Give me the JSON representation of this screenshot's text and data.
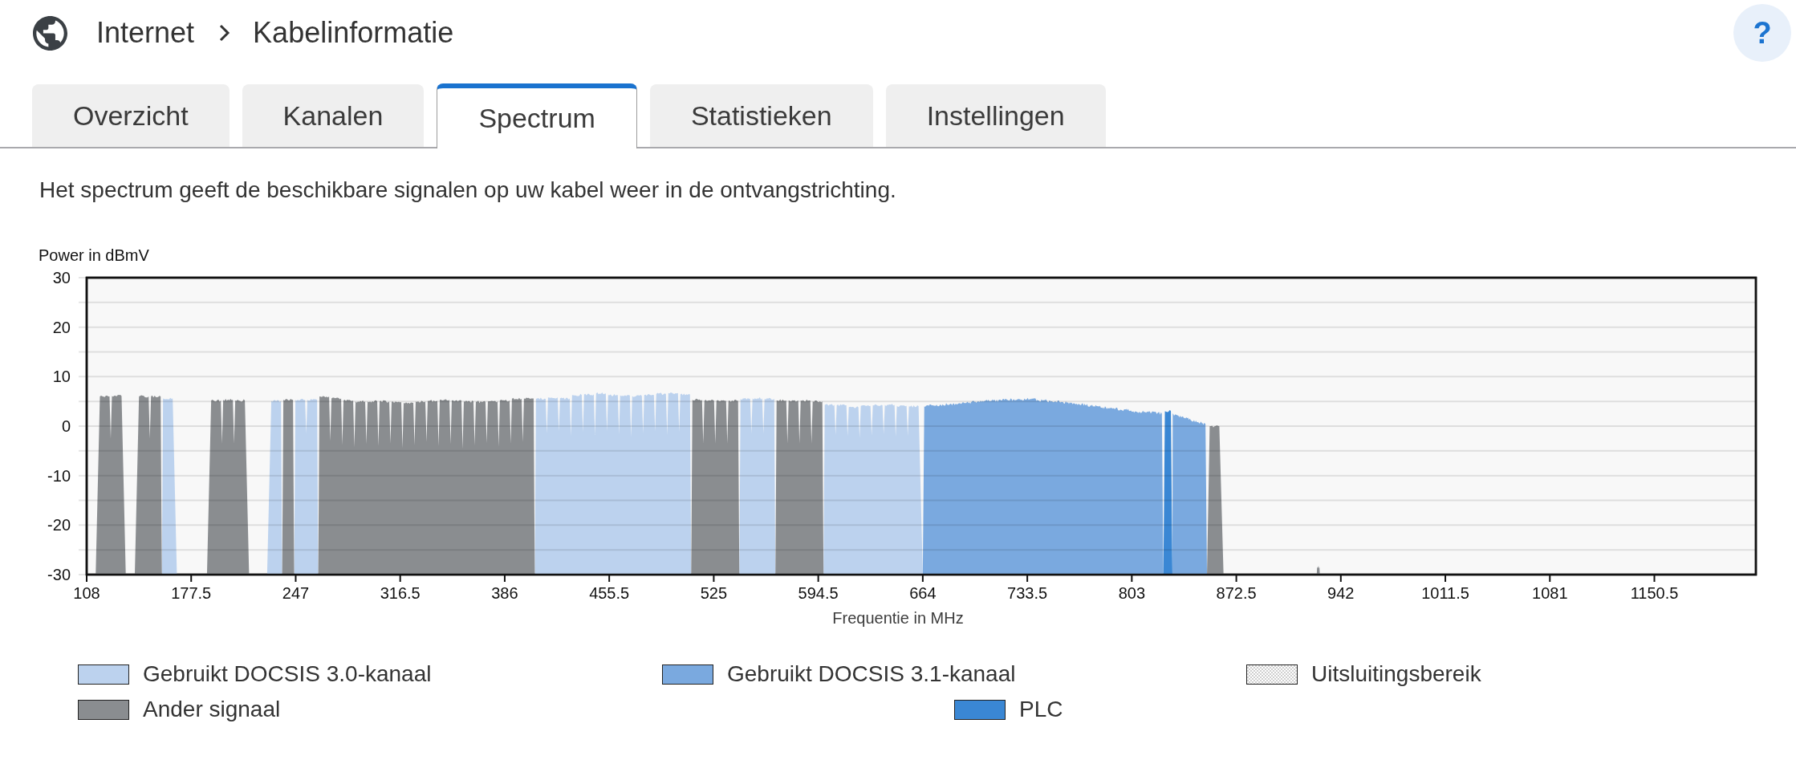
{
  "breadcrumb": [
    {
      "label": "Internet"
    },
    {
      "label": "Kabelinformatie"
    }
  ],
  "help_button": {
    "label": "?"
  },
  "tabs": [
    {
      "label": "Overzicht",
      "selected": false
    },
    {
      "label": "Kanalen",
      "selected": false
    },
    {
      "label": "Spectrum",
      "selected": true
    },
    {
      "label": "Statistieken",
      "selected": false
    },
    {
      "label": "Instellingen",
      "selected": false
    }
  ],
  "description": "Het spectrum geeft de beschikbare signalen op uw kabel weer in de ontvangstrichting.",
  "spectrum": {
    "chart_data": {
      "type": "area",
      "ylabel": "Power in dBmV",
      "xlabel": "Frequentie in MHz",
      "grid": true,
      "legend": true,
      "x": [
        114,
        120,
        124,
        128,
        134,
        140,
        146,
        150,
        154,
        158,
        162,
        168,
        188,
        194,
        198,
        202,
        206,
        210,
        216,
        228,
        234,
        238,
        242,
        246,
        250,
        254,
        258,
        262,
        266,
        270,
        274,
        278,
        282,
        286,
        290,
        294,
        298,
        302,
        306,
        310,
        314,
        318,
        322,
        326,
        330,
        334,
        338,
        342,
        346,
        350,
        354,
        358,
        362,
        366,
        370,
        374,
        378,
        382,
        386,
        390,
        394,
        398,
        402,
        406,
        410,
        414,
        418,
        422,
        426,
        430,
        434,
        438,
        442,
        446,
        450,
        454,
        458,
        462,
        466,
        470,
        474,
        478,
        482,
        486,
        490,
        494,
        498,
        502,
        506,
        510,
        514,
        518,
        522,
        526,
        530,
        534,
        538,
        542,
        546,
        550,
        554,
        558,
        562,
        566,
        570,
        574,
        578,
        582,
        586,
        590,
        594,
        598,
        602,
        606,
        610,
        614,
        618,
        622,
        626,
        630,
        634,
        638,
        642,
        646,
        650,
        654,
        658,
        664,
        665,
        668,
        672,
        676,
        680,
        684,
        688,
        692,
        696,
        700,
        704,
        708,
        712,
        716,
        720,
        724,
        728,
        732,
        736,
        740,
        744,
        748,
        752,
        756,
        760,
        764,
        768,
        772,
        776,
        780,
        784,
        788,
        792,
        796,
        800,
        804,
        808,
        812,
        816,
        820,
        823,
        824,
        825,
        829,
        830,
        831,
        834,
        838,
        842,
        846,
        850,
        852,
        853,
        858,
        864,
        926,
        927,
        928
      ],
      "series": [
        {
          "name": "Gebruikt DOCSIS 3.0-kanaal",
          "color": "#bcd2ee",
          "values": [
            null,
            null,
            null,
            null,
            null,
            null,
            null,
            null,
            null,
            -30,
            5.6,
            -30,
            null,
            null,
            null,
            null,
            null,
            null,
            null,
            -30,
            5.1,
            -30,
            null,
            -30,
            5.3,
            -1.5,
            5.3,
            -30,
            null,
            null,
            null,
            null,
            null,
            null,
            null,
            null,
            null,
            null,
            null,
            null,
            null,
            null,
            null,
            null,
            null,
            null,
            null,
            null,
            null,
            null,
            null,
            null,
            null,
            null,
            null,
            null,
            null,
            null,
            null,
            null,
            null,
            null,
            null,
            -30,
            5.5,
            -1.5,
            5.8,
            -1.0,
            5.6,
            -2.0,
            6.3,
            -1.2,
            6.4,
            -1.8,
            6.6,
            -1.0,
            6.3,
            -1.6,
            6.2,
            -2.2,
            6.1,
            -1.4,
            6.3,
            -1.0,
            6.5,
            -1.8,
            6.7,
            -1.2,
            6.4,
            -30,
            null,
            null,
            null,
            null,
            null,
            null,
            null,
            -30,
            5.5,
            -1.5,
            5.6,
            -1.5,
            5.5,
            -30,
            null,
            null,
            null,
            null,
            null,
            null,
            null,
            -30,
            4.3,
            -1.8,
            4.2,
            -2.0,
            3.8,
            -2.4,
            4.1,
            -1.9,
            4.2,
            -1.6,
            4.3,
            -2.1,
            4.1,
            -2.0,
            4.0,
            -30,
            null,
            null,
            null,
            null,
            null,
            null,
            null,
            null,
            null,
            null,
            null,
            null,
            null,
            null,
            null,
            null,
            null,
            null,
            null,
            null,
            null,
            null,
            null,
            null,
            null,
            null,
            null,
            null,
            null,
            null,
            null,
            null,
            null,
            null,
            null,
            null,
            null,
            null,
            null,
            null,
            null,
            null,
            null,
            null,
            null,
            null,
            null,
            null,
            null,
            null,
            null,
            null,
            null,
            null,
            null,
            null,
            null,
            null
          ]
        },
        {
          "name": "Gebruikt DOCSIS 3.1-kanaal",
          "color": "#7aa9df",
          "values": [
            null,
            null,
            null,
            null,
            null,
            null,
            null,
            null,
            null,
            null,
            null,
            null,
            null,
            null,
            null,
            null,
            null,
            null,
            null,
            null,
            null,
            null,
            null,
            null,
            null,
            null,
            null,
            null,
            null,
            null,
            null,
            null,
            null,
            null,
            null,
            null,
            null,
            null,
            null,
            null,
            null,
            null,
            null,
            null,
            null,
            null,
            null,
            null,
            null,
            null,
            null,
            null,
            null,
            null,
            null,
            null,
            null,
            null,
            null,
            null,
            null,
            null,
            null,
            null,
            null,
            null,
            null,
            null,
            null,
            null,
            null,
            null,
            null,
            null,
            null,
            null,
            null,
            null,
            null,
            null,
            null,
            null,
            null,
            null,
            null,
            null,
            null,
            null,
            null,
            null,
            null,
            null,
            null,
            null,
            null,
            null,
            null,
            null,
            null,
            null,
            null,
            null,
            null,
            null,
            null,
            null,
            null,
            null,
            null,
            null,
            null,
            null,
            null,
            null,
            null,
            null,
            null,
            null,
            null,
            null,
            null,
            null,
            null,
            null,
            null,
            null,
            null,
            -30,
            4.0,
            4.1,
            4.2,
            4.3,
            4.4,
            4.5,
            4.6,
            4.7,
            4.8,
            4.9,
            5.0,
            5.1,
            5.2,
            5.2,
            5.3,
            5.3,
            5.4,
            5.4,
            5.4,
            5.3,
            5.2,
            5.1,
            5.0,
            4.9,
            4.7,
            4.6,
            4.4,
            4.3,
            4.1,
            4.0,
            3.8,
            3.6,
            3.5,
            3.3,
            3.2,
            3.0,
            2.9,
            2.8,
            2.7,
            2.6,
            2.5,
            -30,
            null,
            null,
            -30,
            2.4,
            2.1,
            1.7,
            1.3,
            0.9,
            0.6,
            0.4,
            -30,
            null,
            null,
            null,
            null,
            null
          ]
        },
        {
          "name": "Uitsluitingsbereik",
          "values": [
            null,
            null,
            null,
            null,
            null,
            null,
            null,
            null,
            null,
            null,
            null,
            null,
            null,
            null,
            null,
            null,
            null,
            null,
            null,
            null,
            null,
            null,
            null,
            null,
            null,
            null,
            null,
            null,
            null,
            null,
            null,
            null,
            null,
            null,
            null,
            null,
            null,
            null,
            null,
            null,
            null,
            null,
            null,
            null,
            null,
            null,
            null,
            null,
            null,
            null,
            null,
            null,
            null,
            null,
            null,
            null,
            null,
            null,
            null,
            null,
            null,
            null,
            null,
            null,
            null,
            null,
            null,
            null,
            null,
            null,
            null,
            null,
            null,
            null,
            null,
            null,
            null,
            null,
            null,
            null,
            null,
            null,
            null,
            null,
            null,
            null,
            null,
            null,
            null,
            null,
            null,
            null,
            null,
            null,
            null,
            null,
            null,
            null,
            null,
            null,
            null,
            null,
            null,
            null,
            null,
            null,
            null,
            null,
            null,
            null,
            null,
            null,
            null,
            null,
            null,
            null,
            null,
            null,
            null,
            null,
            null,
            null,
            null,
            null,
            null,
            null,
            null,
            null,
            null,
            null,
            null,
            null,
            null,
            null,
            null,
            null,
            null,
            null,
            null,
            null,
            null,
            null,
            null,
            null,
            null,
            null,
            null,
            null,
            null,
            null,
            null,
            null,
            null,
            null,
            null,
            null,
            null,
            null,
            null,
            null,
            null,
            null,
            null,
            null,
            null,
            null,
            null,
            null,
            null,
            null,
            null,
            null,
            null,
            null,
            null,
            null,
            null,
            null,
            null,
            null,
            null,
            null,
            null,
            null,
            null,
            null
          ]
        },
        {
          "name": "Ander signaal",
          "color": "#8a8d90",
          "values": [
            -30,
            6.0,
            -2.5,
            6.1,
            -30,
            -30,
            6.0,
            -2.5,
            6.0,
            -30,
            null,
            null,
            -30,
            5.2,
            -3.5,
            5.3,
            -3.5,
            5.2,
            -30,
            null,
            null,
            -30,
            5.3,
            -30,
            null,
            null,
            null,
            -30,
            6.0,
            -3.0,
            5.6,
            -3.8,
            5.2,
            -4.2,
            5.0,
            -3.6,
            5.0,
            -4.0,
            5.0,
            -3.5,
            4.9,
            -4.4,
            4.7,
            -3.8,
            5.0,
            -3.2,
            5.1,
            -4.0,
            5.3,
            -3.6,
            5.2,
            -4.6,
            5.0,
            -3.9,
            4.9,
            -3.4,
            5.0,
            -4.1,
            5.2,
            -3.5,
            5.5,
            -3.2,
            5.6,
            -30,
            null,
            null,
            null,
            null,
            null,
            null,
            null,
            null,
            null,
            null,
            null,
            null,
            null,
            null,
            null,
            null,
            null,
            null,
            null,
            null,
            null,
            null,
            null,
            null,
            null,
            -30,
            5.3,
            -3.5,
            5.1,
            -3.5,
            5.1,
            -3.5,
            5.1,
            -30,
            null,
            null,
            null,
            null,
            null,
            -30,
            5.2,
            -3.5,
            5.2,
            -3.5,
            5.2,
            -3.5,
            5.0,
            -30,
            null,
            null,
            null,
            null,
            null,
            null,
            null,
            null,
            null,
            null,
            null,
            null,
            null,
            null,
            null,
            null,
            null,
            null,
            null,
            null,
            null,
            null,
            null,
            null,
            null,
            null,
            null,
            null,
            null,
            null,
            null,
            null,
            null,
            null,
            null,
            null,
            null,
            null,
            null,
            null,
            null,
            null,
            null,
            null,
            null,
            null,
            null,
            null,
            null,
            null,
            null,
            null,
            null,
            null,
            null,
            null,
            null,
            null,
            null,
            null,
            null,
            null,
            null,
            null,
            null,
            null,
            null,
            null,
            -30,
            0.0,
            -30,
            -30,
            -28.5,
            -30
          ]
        },
        {
          "name": "PLC",
          "color": "#3a87d4",
          "values": [
            null,
            null,
            null,
            null,
            null,
            null,
            null,
            null,
            null,
            null,
            null,
            null,
            null,
            null,
            null,
            null,
            null,
            null,
            null,
            null,
            null,
            null,
            null,
            null,
            null,
            null,
            null,
            null,
            null,
            null,
            null,
            null,
            null,
            null,
            null,
            null,
            null,
            null,
            null,
            null,
            null,
            null,
            null,
            null,
            null,
            null,
            null,
            null,
            null,
            null,
            null,
            null,
            null,
            null,
            null,
            null,
            null,
            null,
            null,
            null,
            null,
            null,
            null,
            null,
            null,
            null,
            null,
            null,
            null,
            null,
            null,
            null,
            null,
            null,
            null,
            null,
            null,
            null,
            null,
            null,
            null,
            null,
            null,
            null,
            null,
            null,
            null,
            null,
            null,
            null,
            null,
            null,
            null,
            null,
            null,
            null,
            null,
            null,
            null,
            null,
            null,
            null,
            null,
            null,
            null,
            null,
            null,
            null,
            null,
            null,
            null,
            null,
            null,
            null,
            null,
            null,
            null,
            null,
            null,
            null,
            null,
            null,
            null,
            null,
            null,
            null,
            null,
            null,
            null,
            null,
            null,
            null,
            null,
            null,
            null,
            null,
            null,
            null,
            null,
            null,
            null,
            null,
            null,
            null,
            null,
            null,
            null,
            null,
            null,
            null,
            null,
            null,
            null,
            null,
            null,
            null,
            null,
            null,
            null,
            null,
            null,
            null,
            null,
            null,
            null,
            null,
            null,
            null,
            null,
            -30,
            3.0,
            3.0,
            -30,
            null,
            null,
            null,
            null,
            null,
            null,
            null,
            null,
            null,
            null,
            null,
            null,
            null
          ]
        }
      ],
      "xlim": [
        108,
        1218
      ],
      "ylim": [
        -30,
        30
      ],
      "xticks": [
        108,
        177.5,
        247,
        316.5,
        386,
        455.5,
        525,
        594.5,
        664,
        733.5,
        803,
        872.5,
        942,
        1011.5,
        1081,
        1150.5
      ],
      "yticks": [
        -30,
        -20,
        -10,
        0,
        10,
        20,
        30
      ]
    }
  }
}
